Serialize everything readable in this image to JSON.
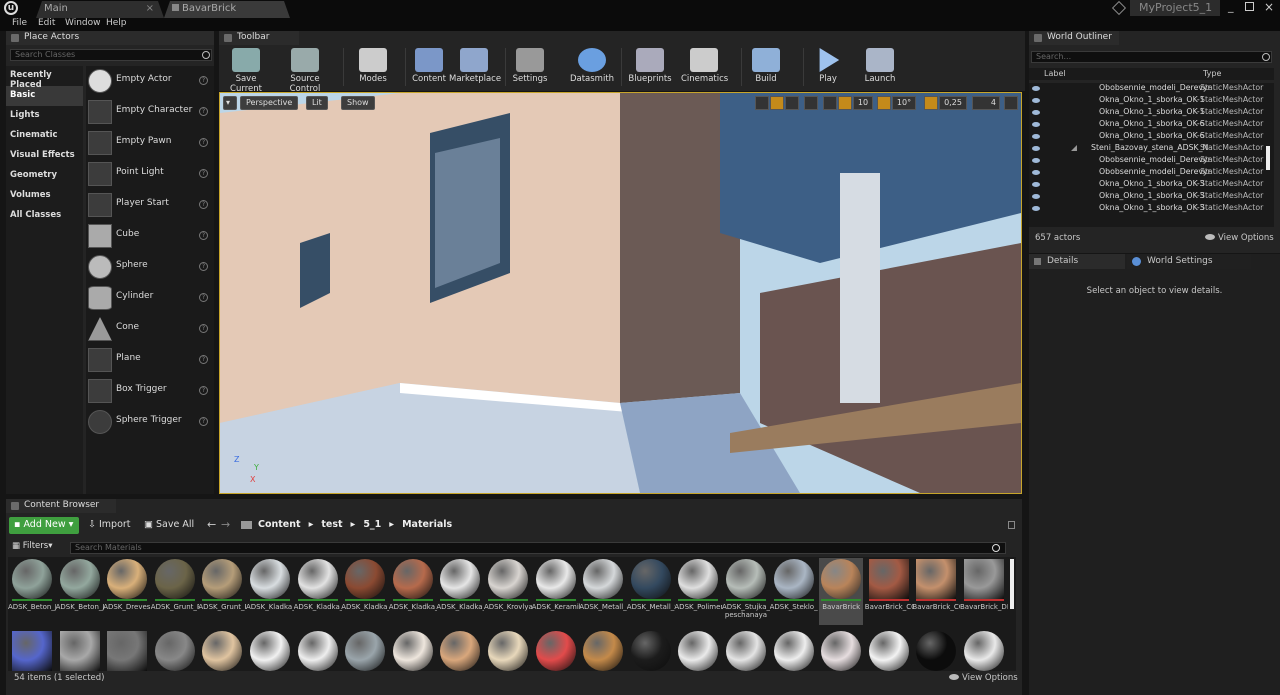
{
  "window": {
    "tabs": [
      "Main",
      "BavarBrick"
    ],
    "project": "MyProject5_1"
  },
  "menu": [
    "File",
    "Edit",
    "Window",
    "Help"
  ],
  "place_actors": {
    "title": "Place Actors",
    "search_placeholder": "Search Classes",
    "categories": [
      "Recently Placed",
      "Basic",
      "Lights",
      "Cinematic",
      "Visual Effects",
      "Geometry",
      "Volumes",
      "All Classes"
    ],
    "selected_category": "Basic",
    "items": [
      "Empty Actor",
      "Empty Character",
      "Empty Pawn",
      "Point Light",
      "Player Start",
      "Cube",
      "Sphere",
      "Cylinder",
      "Cone",
      "Plane",
      "Box Trigger",
      "Sphere Trigger"
    ]
  },
  "toolbar": {
    "title": "Toolbar",
    "buttons": [
      "Save Current",
      "Source Control",
      "Modes",
      "Content",
      "Marketplace",
      "Settings",
      "Datasmith",
      "Blueprints",
      "Cinematics",
      "Build",
      "Play",
      "Launch"
    ]
  },
  "viewport": {
    "perspective": "Perspective",
    "lit": "Lit",
    "show": "Show",
    "grid": "10",
    "angle": "10°",
    "scale": "0,25",
    "camera": "4",
    "axis_x": "X",
    "axis_y": "Y",
    "axis_z": "Z"
  },
  "outliner": {
    "title": "World Outliner",
    "search_placeholder": "Search...",
    "col_label": "Label",
    "col_type": "Type",
    "rows": [
      {
        "label": "Obobsennie_modeli_Derevyr",
        "type": "StaticMeshActor"
      },
      {
        "label": "Okna_Okno_1_sborka_OK-1",
        "type": "StaticMeshActor"
      },
      {
        "label": "Okna_Okno_1_sborka_OK-1",
        "type": "StaticMeshActor"
      },
      {
        "label": "Okna_Okno_1_sborka_OK-6",
        "type": "StaticMeshActor"
      },
      {
        "label": "Okna_Okno_1_sborka_OK-6",
        "type": "StaticMeshActor"
      },
      {
        "label": "Steni_Bazovay_stena_ADSK_N",
        "type": "StaticMeshActor"
      },
      {
        "label": "Obobsennie_modeli_Derevyr",
        "type": "StaticMeshActor"
      },
      {
        "label": "Obobsennie_modeli_Derevyr",
        "type": "StaticMeshActor"
      },
      {
        "label": "Okna_Okno_1_sborka_OK-3",
        "type": "StaticMeshActor"
      },
      {
        "label": "Okna_Okno_1_sborka_OK-3",
        "type": "StaticMeshActor"
      },
      {
        "label": "Okna_Okno_1_sborka_OK-3",
        "type": "StaticMeshActor"
      }
    ],
    "count": "657 actors",
    "view_options": "View Options"
  },
  "details": {
    "tab1": "Details",
    "tab2": "World Settings",
    "empty": "Select an object to view details."
  },
  "content_browser": {
    "title": "Content Browser",
    "add_new": "Add New",
    "import": "Import",
    "save_all": "Save All",
    "path": [
      "Content",
      "test",
      "5_1",
      "Materials"
    ],
    "filters": "Filters",
    "search_placeholder": "Search Materials",
    "assets": [
      {
        "name": "ADSK_Beton_Jelezobeton",
        "color": "#8fa29a"
      },
      {
        "name": "ADSK_Beton_Jelezobeton_sborniy",
        "color": "#93a89e"
      },
      {
        "name": "ADSK_Drevesina_Bereza",
        "color": "#d9b07a"
      },
      {
        "name": "ADSK_Grunt_Pocva",
        "color": "#6b6448"
      },
      {
        "name": "ADSK_Grunt_Pesok_krupniy",
        "color": "#b59d79"
      },
      {
        "name": "ADSK_Kladka_Bloki_Keramoblok",
        "color": "#d8dde0"
      },
      {
        "name": "ADSK_Kladka_Kirpic_Oblitsovochn",
        "color": "#e2e2e2"
      },
      {
        "name": "ADSK_Kladka_Kirpic_Oblitsovochn",
        "color": "#8b4a32"
      },
      {
        "name": "ADSK_Kladka_Kirpic_Ryadovoy",
        "color": "#b66a4c"
      },
      {
        "name": "ADSK_Kladka_Kirpic_Ryadovoy",
        "color": "#e5e5e5"
      },
      {
        "name": "ADSK_Krovlya_Bitumnaya_Plitka",
        "color": "#d8d4d0"
      },
      {
        "name": "ADSK_Keramika_Fayans_beliy",
        "color": "#e9e9e9"
      },
      {
        "name": "ADSK_Metall_Okrasenniy_Beliy_matoviy",
        "color": "#d5d8da"
      },
      {
        "name": "ADSK_Metall_Stal_nerjaveyushch",
        "color": "#33495f"
      },
      {
        "name": "ADSK_Polimeri_Polivinilhlorid",
        "color": "#dfdfdf"
      },
      {
        "name": "ADSK_Stujka_Cementno-peschanaya",
        "color": "#b6bdb8"
      },
      {
        "name": "ADSK_Steklo_Prozrachnoe_bestsvetnoe",
        "color": "#aab6c4"
      },
      {
        "name": "BavarBrick",
        "color": "#b9845a"
      },
      {
        "name": "BavarBrick_COLOR",
        "color": "#a35a44"
      },
      {
        "name": "BavarBrick_COLOR_Mat",
        "color": "#c4906c"
      },
      {
        "name": "BavarBrick_DISP",
        "color": "#999999"
      }
    ],
    "row2": [
      "#5566cc",
      "#a8a8a8",
      "#777777",
      "#888888",
      "#e0c4a0",
      "#f1f1f1",
      "#eeeeee",
      "#9aa5ab",
      "#eee6dd",
      "#d9a77c",
      "#e8d8bb",
      "#e24b4b",
      "#c48a4a",
      "#1c1c1c",
      "#eaeaea",
      "#e4e4e4",
      "#eeeeee",
      "#e6dddf",
      "#f3f3f3",
      "#0c0c0c",
      "#e9e9e9"
    ],
    "status": "54 items (1 selected)",
    "view_options": "View Options"
  }
}
